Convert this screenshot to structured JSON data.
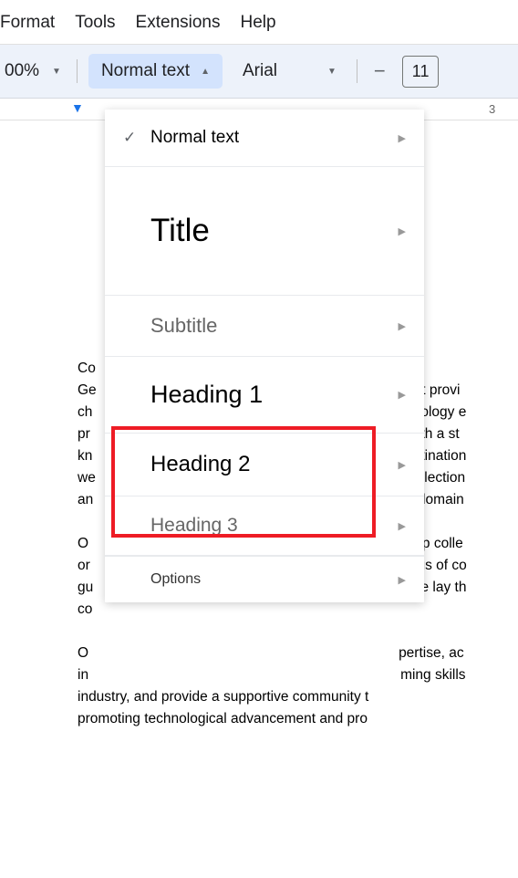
{
  "menubar": {
    "format": "Format",
    "tools": "Tools",
    "extensions": "Extensions",
    "help": "Help"
  },
  "toolbar": {
    "zoom": "00%",
    "style": "Normal text",
    "font": "Arial",
    "font_size": "11"
  },
  "ruler": {
    "number": "3"
  },
  "dropdown": {
    "normal": "Normal text",
    "title": "Title",
    "subtitle": "Subtitle",
    "heading1": "Heading 1",
    "heading2": "Heading 2",
    "heading3": "Heading 3",
    "options": "Options"
  },
  "document": {
    "p1_line1": "Co",
    "p1_line2": "Ge",
    "p1_line2_right": "that provi",
    "p1_line3": "ch",
    "p1_line3_right": "chnology e",
    "p1_line4": "pr",
    "p1_line4_right": ". With a st",
    "p1_line5": "kn",
    "p1_line5_right": "destination",
    "p1_line6": "we",
    "p1_line6_right": "t collection",
    "p1_line7": "an",
    "p1_line7_right": "us domain",
    "p2_line1": "O",
    "p2_line1_right": "n top colle",
    "p2_line2": "or",
    "p2_line2_right": "nings of co",
    "p2_line3": "gu",
    "p2_line3_right": "s we lay th",
    "p2_line4": "co",
    "p3_line1": "O",
    "p3_line1_right": "pertise, ac",
    "p3_line2": "in",
    "p3_line2_right": "ming skills",
    "p3_full": "industry, and provide a supportive community t",
    "p3_cont": "promoting technological advancement and pro"
  }
}
